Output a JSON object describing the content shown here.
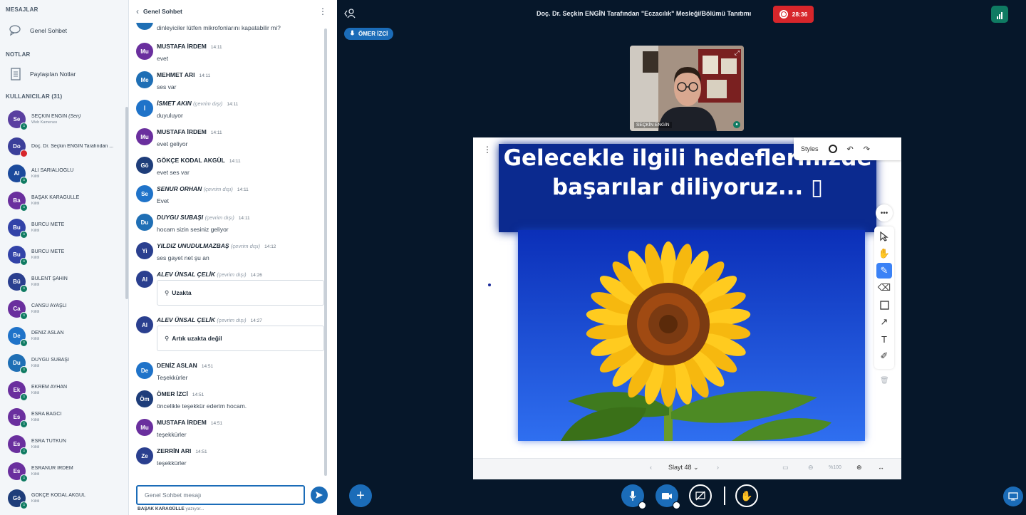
{
  "sidebar": {
    "messages_title": "MESAJLAR",
    "public_chat": "Genel Sohbet",
    "notes_title": "NOTLAR",
    "shared_notes": "Paylaşılan Notlar",
    "users_title": "KULLANICILAR (31)",
    "users": [
      {
        "initials": "Se",
        "name": "SEÇKİN ENGİN",
        "you": "(Sen)",
        "status": "Web Kamerası",
        "color": "#5a3fa0"
      },
      {
        "initials": "Do",
        "name": "Doç. Dr. Seçkin ENGİN Tarafından ...",
        "status": "",
        "color": "#3b3f9a"
      },
      {
        "initials": "Al",
        "name": "ALİ SARIALİOĞLU",
        "status": "Kilitli",
        "color": "#1b4a9c"
      },
      {
        "initials": "Ba",
        "name": "BAŞAK KARAGÜLLE",
        "status": "Kilitli",
        "color": "#6a2f9e"
      },
      {
        "initials": "Bu",
        "name": "BURCU METE",
        "status": "Kilitli",
        "color": "#3243a8"
      },
      {
        "initials": "Bu",
        "name": "BURCU METE",
        "status": "Kilitli",
        "color": "#3243a8"
      },
      {
        "initials": "Bü",
        "name": "BÜLENT ŞAHİN",
        "status": "Kilitli",
        "color": "#2a3f8f"
      },
      {
        "initials": "Ca",
        "name": "CANSU AYAŞLI",
        "status": "Kilitli",
        "color": "#6a2f9e"
      },
      {
        "initials": "De",
        "name": "DENİZ ASLAN",
        "status": "Kilitli",
        "color": "#1f73c9"
      },
      {
        "initials": "Du",
        "name": "DUYGU SUBAŞI",
        "status": "Kilitli",
        "color": "#1f6fb5"
      },
      {
        "initials": "Ek",
        "name": "EKREM AYHAN",
        "status": "Kilitli",
        "color": "#6a2f9e"
      },
      {
        "initials": "Es",
        "name": "ESRA BAĞCI",
        "status": "Kilitli",
        "color": "#6a2f9e"
      },
      {
        "initials": "Es",
        "name": "ESRA TUTKUN",
        "status": "Kilitli",
        "color": "#6a2f9e"
      },
      {
        "initials": "Es",
        "name": "ESRANUR İRDEM",
        "status": "Kilitli",
        "color": "#6a2f9e"
      },
      {
        "initials": "Gö",
        "name": "GÖKÇE KODAL AKGÜL",
        "status": "Kilitli",
        "color": "#1e3d7a"
      }
    ]
  },
  "chat": {
    "title": "Genel Sohbet",
    "first_line": "dinleyiciler lütfen mikrofonlarını kapatabilir mi?",
    "messages": [
      {
        "initials": "Mu",
        "name": "MUSTAFA İRDEM",
        "offline": "",
        "time": "14:11",
        "text": "evet",
        "color": "#6a2f9e"
      },
      {
        "initials": "Me",
        "name": "MEHMET ARI",
        "offline": "",
        "time": "14:11",
        "text": "ses var",
        "color": "#1f6fb5"
      },
      {
        "initials": "İ",
        "name": "İSMET AKIN",
        "offline": "(çevrim dışı)",
        "time": "14:11",
        "text": "duyuluyor",
        "color": "#1f73c9"
      },
      {
        "initials": "Mu",
        "name": "MUSTAFA İRDEM",
        "offline": "",
        "time": "14:11",
        "text": "evet geliyor",
        "color": "#6a2f9e"
      },
      {
        "initials": "Gö",
        "name": "GÖKÇE KODAL AKGÜL",
        "offline": "",
        "time": "14:11",
        "text": "evet ses var",
        "color": "#1e3d7a"
      },
      {
        "initials": "Se",
        "name": "SENUR ORHAN",
        "offline": "(çevrim dışı)",
        "time": "14:11",
        "text": "Evet",
        "color": "#1f73c9"
      },
      {
        "initials": "Du",
        "name": "DUYGU SUBAŞI",
        "offline": "(çevrim dışı)",
        "time": "14:11",
        "text": "hocam sizin sesiniz geliyor",
        "color": "#1f6fb5"
      },
      {
        "initials": "Yi",
        "name": "YILDIZ UNUDULMAZBAŞ",
        "offline": "(çevrim dışı)",
        "time": "14:12",
        "text": "ses gayet net şu an",
        "color": "#2a3f8f"
      },
      {
        "initials": "Al",
        "name": "ALEV ÜNSAL ÇELİK",
        "offline": "(çevrim dışı)",
        "time": "14:26",
        "box": "Uzakta",
        "color": "#2a3f8f"
      },
      {
        "initials": "Al",
        "name": "ALEV ÜNSAL ÇELİK",
        "offline": "(çevrim dışı)",
        "time": "14:27",
        "box": "Artık uzakta değil",
        "color": "#2a3f8f"
      },
      {
        "initials": "De",
        "name": "DENİZ ASLAN",
        "offline": "",
        "time": "14:51",
        "text": "Teşekkürler",
        "color": "#1f73c9"
      },
      {
        "initials": "Öm",
        "name": "ÖMER İZCİ",
        "offline": "",
        "time": "14:51",
        "text": "öncelikle teşekkür ederim hocam.",
        "color": "#1e3d7a"
      },
      {
        "initials": "Mu",
        "name": "MUSTAFA İRDEM",
        "offline": "",
        "time": "14:51",
        "text": "teşekkürler",
        "color": "#6a2f9e"
      },
      {
        "initials": "Ze",
        "name": "ZERRİN ARI",
        "offline": "",
        "time": "14:51",
        "text": "teşekkürler",
        "color": "#2a3f8f"
      }
    ],
    "input_placeholder": "Genel Sohbet mesajı",
    "typing_user": "BAŞAK KARAGÜLLE",
    "typing_text": "yazıyor..."
  },
  "main": {
    "meeting_title": "Doç. Dr. Seçkin ENGİN Tarafından \"Eczacılık\" Mesleği/Bölümü Tanıtımı",
    "recording_time": "28:36",
    "talking_user": "ÖMER İZCİ",
    "webcam_name": "SEÇKİN ENGİN",
    "styles_label": "Styles",
    "slide_title": "Gelecekle ilgili hedeflerinizde başarılar diliyoruz... ▯",
    "slide_label": "Slayt 48",
    "zoom": "%100"
  },
  "colors": {
    "accent": "#1b6cb8",
    "record": "#d7262b",
    "online": "#0f7b62",
    "background": "#06172a"
  }
}
